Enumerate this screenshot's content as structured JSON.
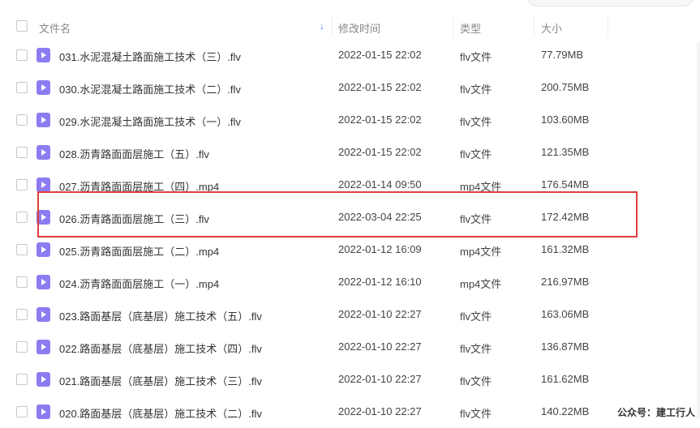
{
  "header": {
    "name": "文件名",
    "modified": "修改时间",
    "type": "类型",
    "size": "大小"
  },
  "sort": {
    "icon": "arrow-down-icon",
    "color": "#3a82f8"
  },
  "files": [
    {
      "name": "031.水泥混凝土路面施工技术（三）.flv",
      "time": "2022-01-15 22:02",
      "type": "flv文件",
      "size": "77.79MB"
    },
    {
      "name": "030.水泥混凝土路面施工技术（二）.flv",
      "time": "2022-01-15 22:02",
      "type": "flv文件",
      "size": "200.75MB"
    },
    {
      "name": "029.水泥混凝土路面施工技术（一）.flv",
      "time": "2022-01-15 22:02",
      "type": "flv文件",
      "size": "103.60MB"
    },
    {
      "name": "028.沥青路面面层施工（五）.flv",
      "time": "2022-01-15 22:02",
      "type": "flv文件",
      "size": "121.35MB"
    },
    {
      "name": "027.沥青路面面层施工（四）.mp4",
      "time": "2022-01-14 09:50",
      "type": "mp4文件",
      "size": "176.54MB"
    },
    {
      "name": "026.沥青路面面层施工（三）.flv",
      "time": "2022-03-04 22:25",
      "type": "flv文件",
      "size": "172.42MB"
    },
    {
      "name": "025.沥青路面面层施工（二）.mp4",
      "time": "2022-01-12 16:09",
      "type": "mp4文件",
      "size": "161.32MB"
    },
    {
      "name": "024.沥青路面面层施工（一）.mp4",
      "time": "2022-01-12 16:10",
      "type": "mp4文件",
      "size": "216.97MB"
    },
    {
      "name": "023.路面基层（底基层）施工技术（五）.flv",
      "time": "2022-01-10 22:27",
      "type": "flv文件",
      "size": "163.06MB"
    },
    {
      "name": "022.路面基层（底基层）施工技术（四）.flv",
      "time": "2022-01-10 22:27",
      "type": "flv文件",
      "size": "136.87MB"
    },
    {
      "name": "021.路面基层（底基层）施工技术（三）.flv",
      "time": "2022-01-10 22:27",
      "type": "flv文件",
      "size": "161.62MB"
    },
    {
      "name": "020.路面基层（底基层）施工技术（二）.flv",
      "time": "2022-01-10 22:27",
      "type": "flv文件",
      "size": "140.22MB"
    }
  ],
  "highlight_color": "#e23c3c",
  "file_icon_color": "#8c7cf2",
  "watermark": "公众号：建工行人"
}
